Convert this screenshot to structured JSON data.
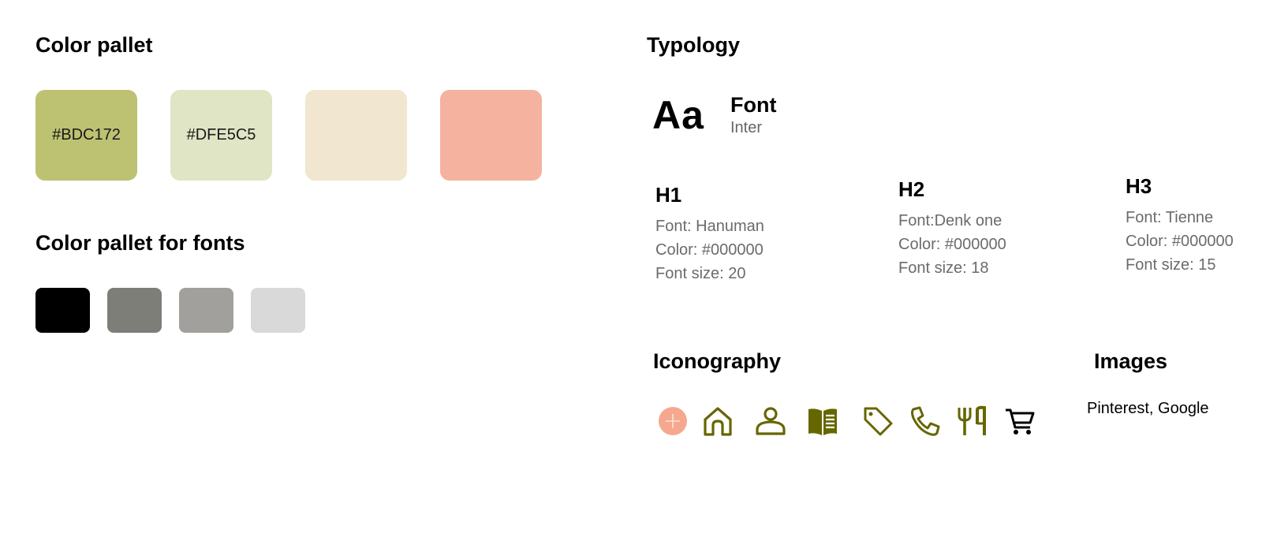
{
  "palette": {
    "title": "Color pallet",
    "swatches": [
      {
        "color": "#BDC172",
        "label": "#BDC172"
      },
      {
        "color": "#DFE5C5",
        "label": "#DFE5C5"
      },
      {
        "color": "#F1E6D0",
        "label": ""
      },
      {
        "color": "#F5B29F",
        "label": ""
      }
    ]
  },
  "font_palette": {
    "title": "Color pallet for fonts",
    "swatches": [
      "#000000",
      "#7E7E79",
      "#A2A09C",
      "#D9D9D9"
    ]
  },
  "typology": {
    "title": "Typology",
    "sample": "Aa",
    "font_label": "Font",
    "font_name": "Inter",
    "headings": [
      {
        "name": "H1",
        "font": "Font: Hanuman",
        "color": "Color: #000000",
        "size": "Font size: 20"
      },
      {
        "name": "H2",
        "font": "Font:Denk one",
        "color": "Color: #000000",
        "size": "Font size: 18"
      },
      {
        "name": "H3",
        "font": "Font: Tienne",
        "color": "Color: #000000",
        "size": "Font size: 15"
      }
    ]
  },
  "iconography": {
    "title": "Iconography",
    "icons": [
      "plus-circle-icon",
      "home-icon",
      "user-icon",
      "book-open-icon",
      "tag-icon",
      "phone-icon",
      "utensils-icon",
      "cart-icon"
    ],
    "accent_color": "#666600",
    "plus_color": "#F5A88E"
  },
  "images": {
    "title": "Images",
    "text": "Pinterest, Google"
  }
}
